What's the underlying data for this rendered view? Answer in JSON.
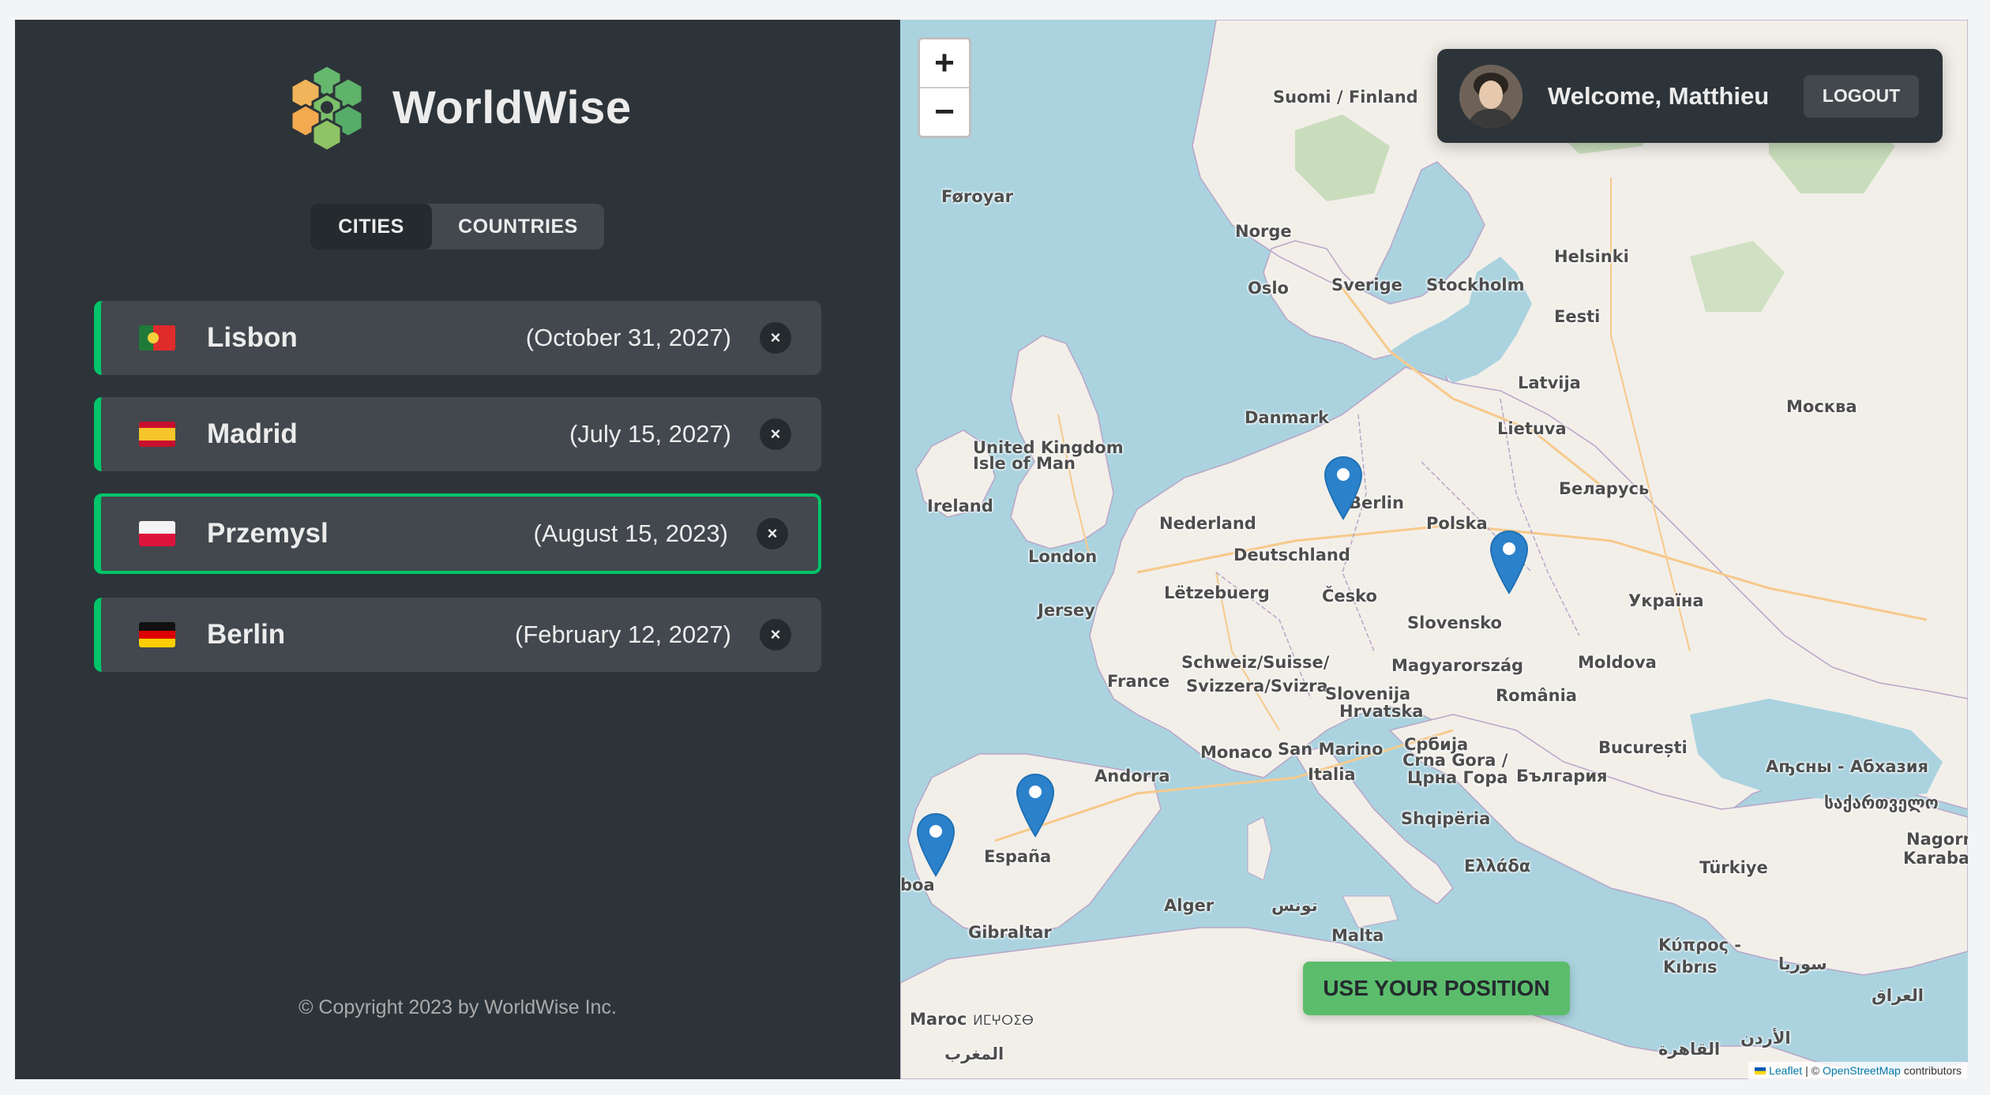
{
  "app": {
    "name": "WorldWise"
  },
  "tabs": [
    {
      "label": "CITIES",
      "active": true
    },
    {
      "label": "COUNTRIES",
      "active": false
    }
  ],
  "cities": [
    {
      "name": "Lisbon",
      "date": "(October 31, 2027)",
      "flag": "portugal-flag-icon",
      "active": false
    },
    {
      "name": "Madrid",
      "date": "(July 15, 2027)",
      "flag": "spain-flag-icon",
      "active": false
    },
    {
      "name": "Przemysl",
      "date": "(August 15, 2023)",
      "flag": "poland-flag-icon",
      "active": true
    },
    {
      "name": "Berlin",
      "date": "(February 12, 2027)",
      "flag": "germany-flag-icon",
      "active": false
    }
  ],
  "delete_symbol": "×",
  "footer": {
    "copyright": "© Copyright 2023 by WorldWise Inc."
  },
  "map": {
    "zoom_in": "+",
    "zoom_out": "−",
    "user": {
      "welcome": "Welcome, Matthieu",
      "logout": "LOGOUT"
    },
    "position_button": "USE YOUR POSITION",
    "attribution": {
      "leaflet": "Leaflet",
      "separator": "| ©",
      "osm": "OpenStreetMap",
      "suffix": "contributors"
    },
    "labels": [
      "Suomi / Finland",
      "Føroyar",
      "Norge",
      "Oslo",
      "Sverige",
      "Stockholm",
      "Helsinki",
      "Eesti",
      "Latvija",
      "Москва",
      "Danmark",
      "Lietuva",
      "United Kingdom",
      "Isle of Man",
      "Berlin",
      "Беларусь",
      "Ireland",
      "Nederland",
      "Polska",
      "London",
      "Deutschland",
      "Lëtzebuerg",
      "Česko",
      "Україна",
      "Jersey",
      "Slovensko",
      "Schweiz/Suisse/",
      "Svizzera/Svizra",
      "Magyarország",
      "Moldova",
      "France",
      "Slovenija",
      "Hrvatska",
      "România",
      "Monaco",
      "San Marino",
      "Србија",
      "Crna Gora /",
      "Црна Гора",
      "București",
      "Andorra",
      "Italia",
      "България",
      "Аҧсны - Абхазия",
      "საქართველო",
      "Shqipëria",
      "España",
      "Nagorn",
      "Karabak",
      "boa",
      "Ελλάδα",
      "Türkiye",
      "Alger",
      "تونس",
      "Gibraltar",
      "Malta",
      "Κύπρος -",
      "Kıbrıs",
      "سوريا",
      "Maroc",
      "ⵍⵎⵖⵔⵉⴱ",
      "العراق",
      "المغرب",
      "الأردن",
      "القاهرة"
    ],
    "colors": {
      "accent": "#00c46a",
      "sea": "#aad3df",
      "land": "#f2efe9",
      "marker": "#2b82cb"
    }
  }
}
